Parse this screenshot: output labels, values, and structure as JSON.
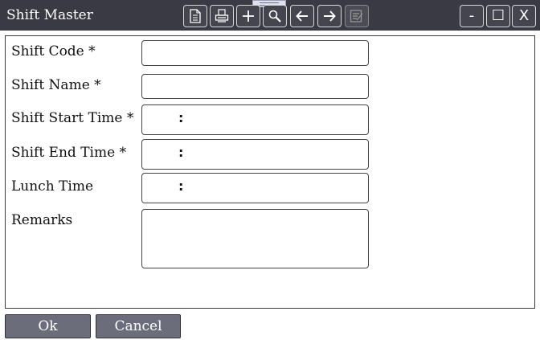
{
  "window": {
    "title": "Shift Master"
  },
  "toolbar": {
    "icons": [
      "document-icon",
      "print-icon",
      "add-icon",
      "search-icon",
      "arrow-left-icon",
      "arrow-right-icon",
      "edit-icon"
    ],
    "minimize_label": "-",
    "maximize_label": "☐",
    "close_label": "X"
  },
  "form": {
    "shift_code": {
      "label": "Shift Code *",
      "value": ""
    },
    "shift_name": {
      "label": "Shift Name *",
      "value": ""
    },
    "shift_start_time": {
      "label": "Shift Start Time *",
      "separator": ":"
    },
    "shift_end_time": {
      "label": "Shift End Time *",
      "separator": ":"
    },
    "lunch_time": {
      "label": "Lunch Time",
      "separator": ":"
    },
    "remarks": {
      "label": "Remarks",
      "value": ""
    }
  },
  "actions": {
    "ok_label": "Ok",
    "cancel_label": "Cancel"
  },
  "colors": {
    "titlebar": "#3a3a44",
    "button": "#6b6d7a"
  }
}
